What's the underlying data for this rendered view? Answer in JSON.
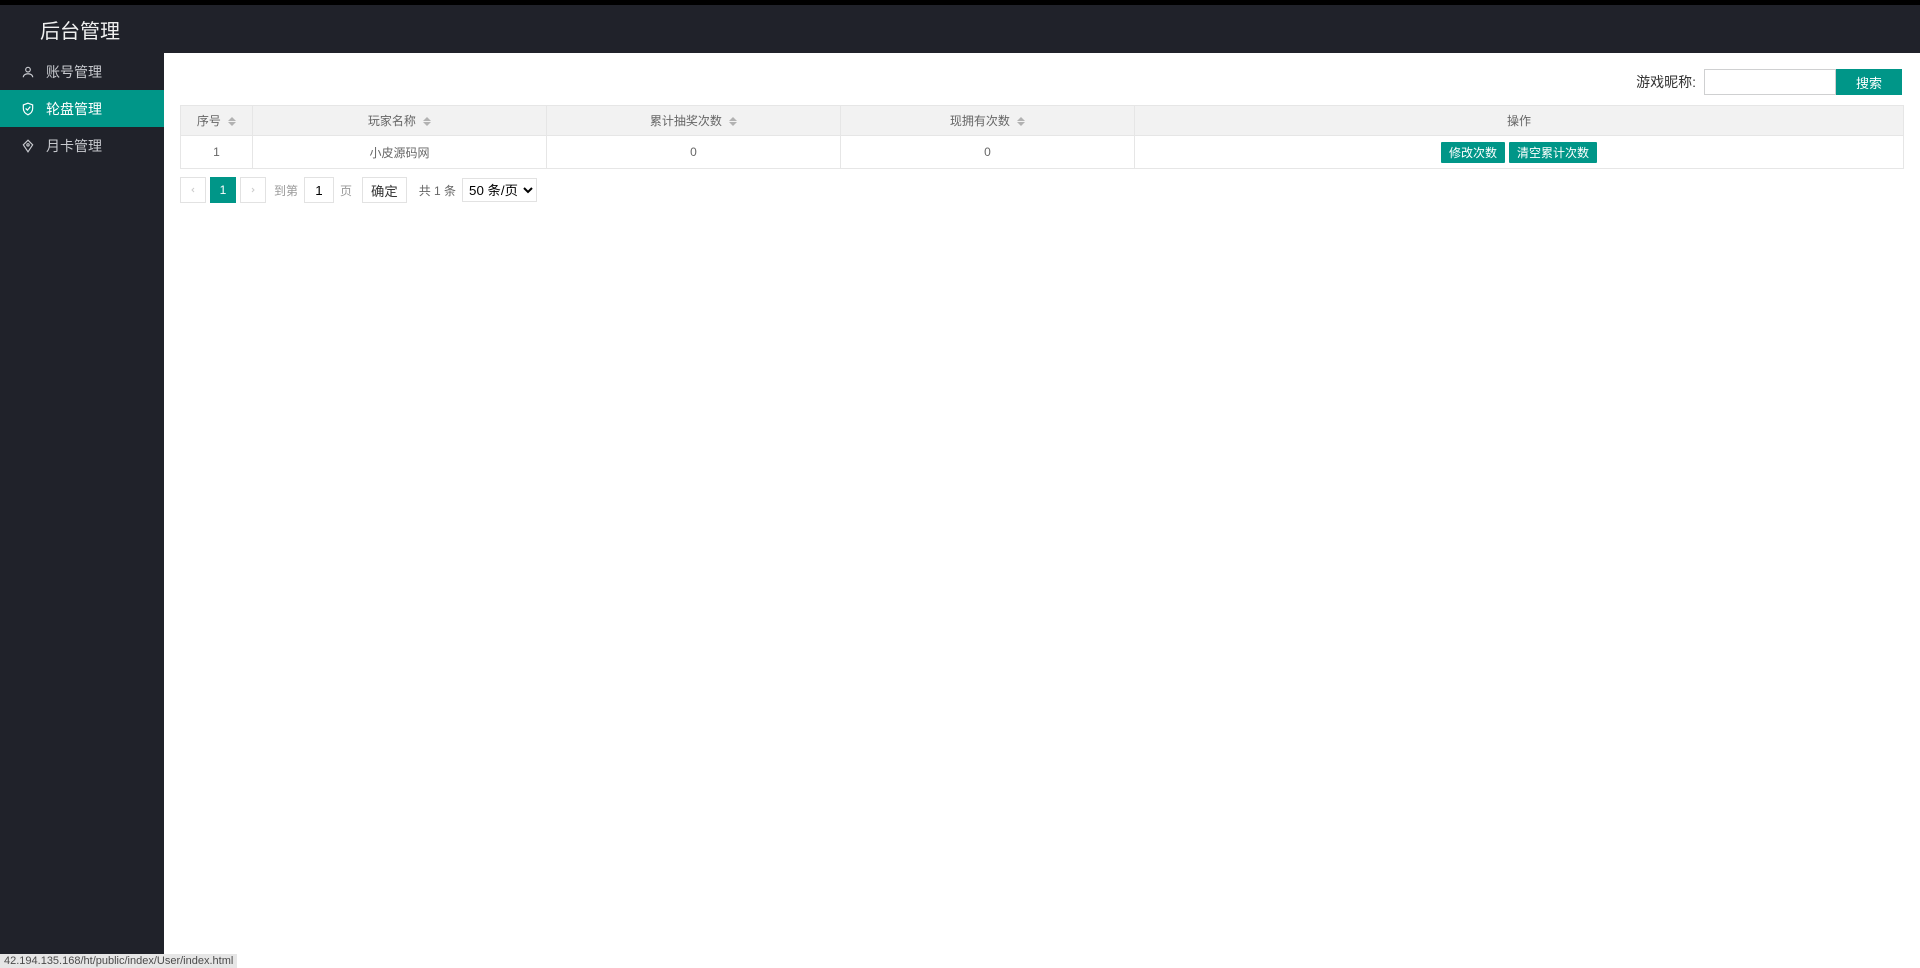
{
  "header": {
    "title": "后台管理"
  },
  "sidebar": {
    "items": [
      {
        "label": "账号管理",
        "icon": "user"
      },
      {
        "label": "轮盘管理",
        "icon": "shield"
      },
      {
        "label": "月卡管理",
        "icon": "diamond"
      }
    ],
    "active_index": 1
  },
  "search": {
    "label": "游戏昵称:",
    "value": "",
    "button": "搜索"
  },
  "table": {
    "columns": [
      "序号",
      "玩家名称",
      "累计抽奖次数",
      "现拥有次数",
      "操作"
    ],
    "rows": [
      {
        "seq": "1",
        "name": "小皮源码网",
        "total_draws": "0",
        "current_has": "0",
        "actions": [
          "修改次数",
          "清空累计次数"
        ]
      }
    ]
  },
  "pagination": {
    "current": "1",
    "goto_prefix": "到第",
    "goto_value": "1",
    "goto_suffix": "页",
    "confirm": "确定",
    "total": "共 1 条",
    "per_page": "50 条/页"
  },
  "status_url": "42.194.135.168/ht/public/index/User/index.html",
  "colors": {
    "accent": "#009688",
    "dark": "#20222a"
  }
}
